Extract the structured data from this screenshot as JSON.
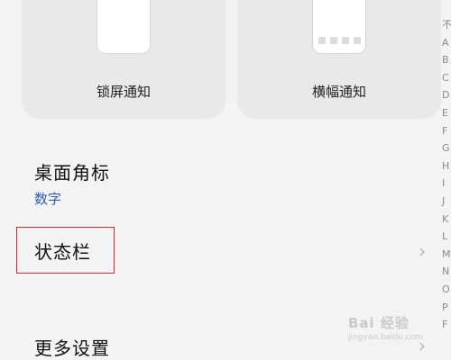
{
  "cards": {
    "lock_screen_label": "锁屏通知",
    "banner_label": "横幅通知"
  },
  "rows": {
    "desktop_badge_title": "桌面角标",
    "desktop_badge_value": "数字",
    "status_bar_title": "状态栏",
    "more_settings_title": "更多设置"
  },
  "index_letters": [
    "不",
    "A",
    "B",
    "C",
    "D",
    "E",
    "F",
    "G",
    "H",
    "I",
    "J",
    "K",
    "L",
    "M",
    "N",
    "O",
    "P",
    "F"
  ],
  "watermark": {
    "main": "Bai 经验",
    "sub": "jingyan.baidu.com"
  },
  "colors": {
    "accent_blue": "#2a5dbd",
    "highlight_red": "#d62b2b",
    "background": "#f3f3f3"
  }
}
